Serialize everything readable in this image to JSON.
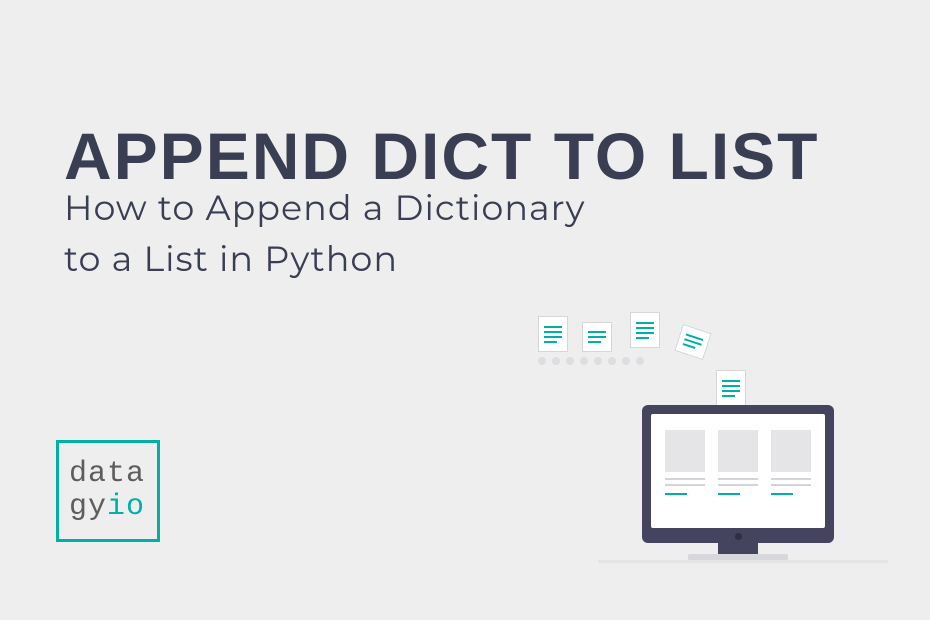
{
  "heading": "APPEND DICT TO LIST",
  "subheading_line1": "How to Append a Dictionary",
  "subheading_line2": "to a List in Python",
  "logo": {
    "line1": "data",
    "gy": "gy",
    "io": "io"
  }
}
